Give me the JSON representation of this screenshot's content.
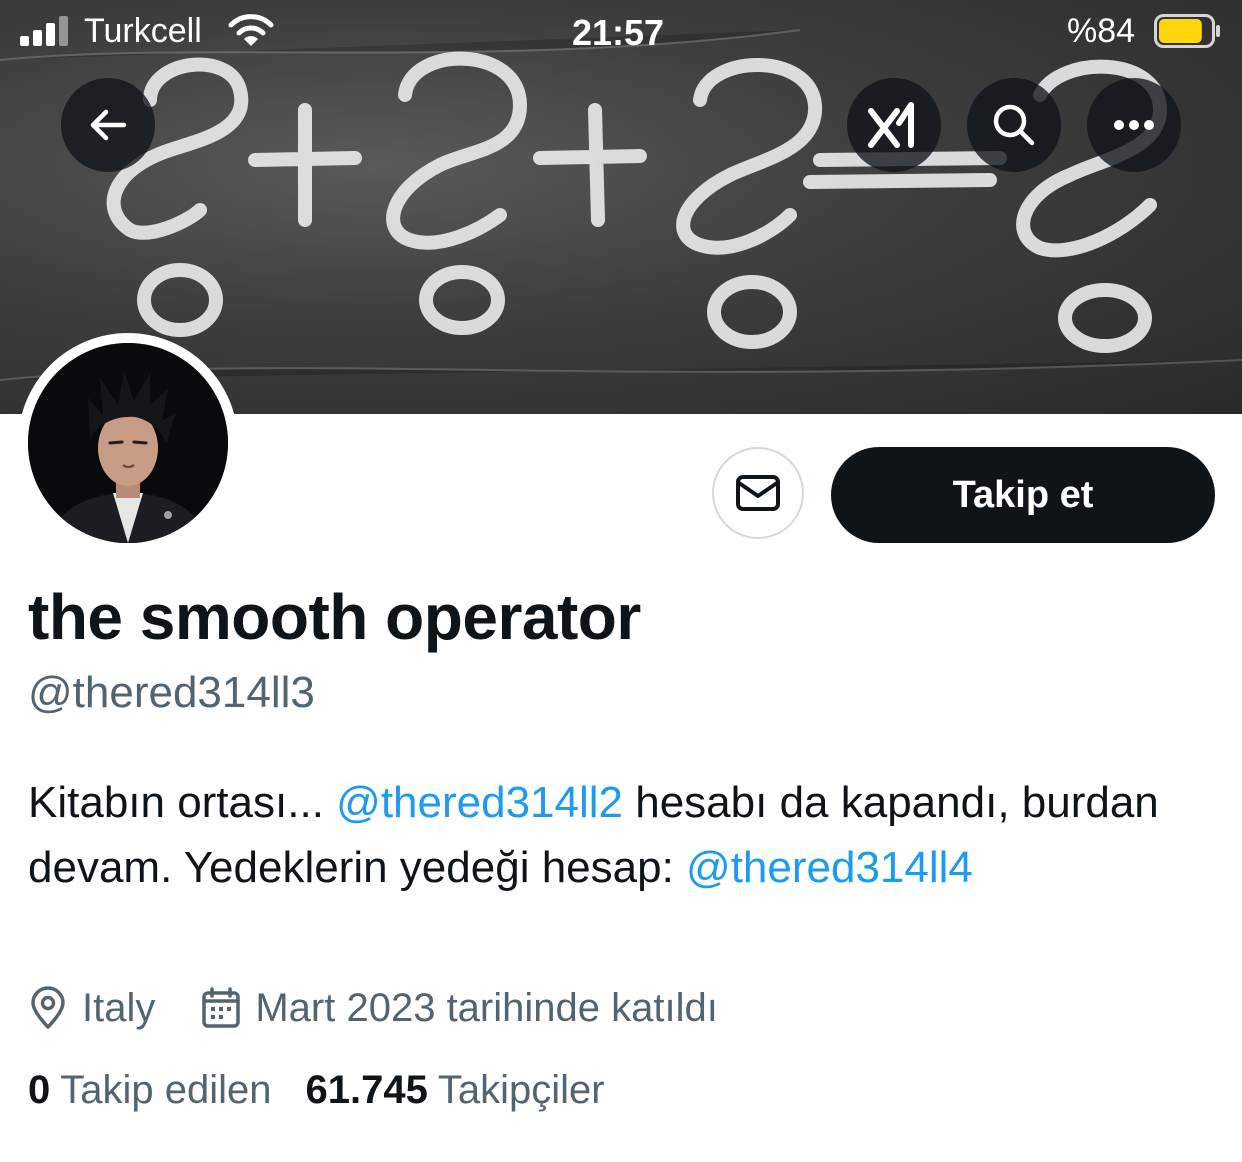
{
  "status_bar": {
    "carrier": "Turkcell",
    "time": "21:57",
    "battery_percent": "%84",
    "battery_level": 0.84,
    "battery_color": "#ffd60a"
  },
  "header": {
    "back_icon": "arrow-left-icon",
    "grok_icon": "grok-icon",
    "search_icon": "search-icon",
    "more_icon": "more-horizontal-icon"
  },
  "profile": {
    "display_name": "the smooth operator",
    "handle": "@thered314ll3",
    "follow_label": "Takip et",
    "message_icon": "envelope-icon",
    "bio": {
      "part1": "Kitabın ortası... ",
      "mention1": "@thered314ll2",
      "part2": " hesabı da kapandı, burdan devam. Yedeklerin yedeği hesap: ",
      "mention2": "@thered314ll4"
    },
    "location": "Italy",
    "joined": "Mart 2023 tarihinde katıldı",
    "following_count": "0",
    "following_label": "Takip edilen",
    "followers_count": "61.745",
    "followers_label": "Takipçiler"
  },
  "colors": {
    "accent_link": "#1d9bf0",
    "primary_text": "#0f1419",
    "secondary_text": "#536471",
    "follow_button_bg": "#0f1419"
  }
}
